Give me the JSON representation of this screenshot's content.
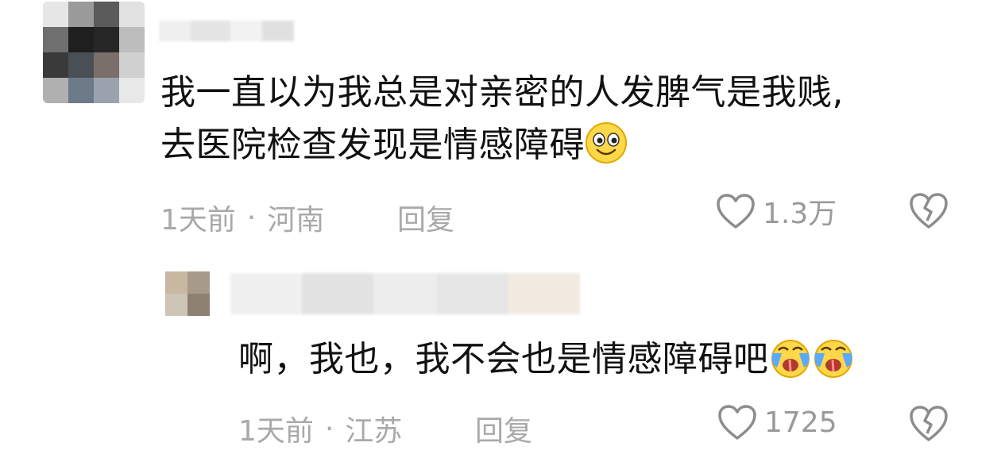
{
  "comments": [
    {
      "text_line1": "我一直以为我总是对亲密的人发脾气是我贱,",
      "text_line2": "去医院检查发现是情感障碍",
      "emoji": "smile-emoji",
      "time": "1天前",
      "separator": "·",
      "location": "河南",
      "reply_label": "回复",
      "likes": "1.3万"
    },
    {
      "text": "啊，我也，我不会也是情感障碍吧",
      "emoji": "crying-emoji",
      "time": "1天前",
      "separator": "·",
      "location": "江苏",
      "reply_label": "回复",
      "likes": "1725"
    }
  ],
  "icons": {
    "like": "heart-outline-icon",
    "dislike": "broken-heart-icon"
  },
  "colors": {
    "text": "#111111",
    "meta": "#a9a9a9",
    "emoji_yellow": "#ffd84a",
    "tear_blue": "#5aa9ff"
  }
}
